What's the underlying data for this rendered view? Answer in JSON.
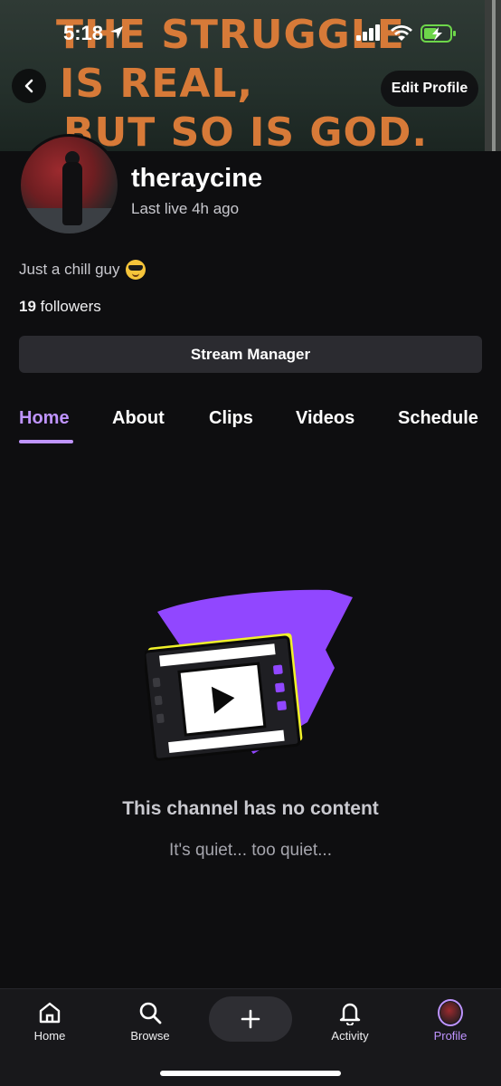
{
  "status_bar": {
    "time": "5:18"
  },
  "banner": {
    "lines": [
      "THE STRUGGLE",
      "IS REAL,",
      "BUT SO IS GOD."
    ]
  },
  "header": {
    "edit_profile_label": "Edit Profile"
  },
  "profile": {
    "username": "theraycine",
    "last_live": "Last live 4h ago",
    "bio": "Just a chill guy",
    "bio_emoji": "sunglasses-emoji",
    "followers_count": "19",
    "followers_label": "followers",
    "stream_manager_label": "Stream Manager"
  },
  "tabs": [
    {
      "label": "Home",
      "active": true
    },
    {
      "label": "About",
      "active": false
    },
    {
      "label": "Clips",
      "active": false
    },
    {
      "label": "Videos",
      "active": false
    },
    {
      "label": "Schedule",
      "active": false
    }
  ],
  "empty_state": {
    "title": "This channel has no content",
    "subtitle": "It's quiet... too quiet..."
  },
  "bottom_nav": {
    "items": [
      {
        "label": "Home",
        "icon": "home-icon"
      },
      {
        "label": "Browse",
        "icon": "search-icon"
      },
      {
        "label": "",
        "icon": "plus-icon"
      },
      {
        "label": "Activity",
        "icon": "bell-icon"
      },
      {
        "label": "Profile",
        "icon": "avatar-icon",
        "active": true
      }
    ]
  },
  "colors": {
    "accent": "#bf94ff",
    "background": "#0e0e10",
    "banner_text": "#d77a38",
    "illustration_purple": "#9147ff",
    "illustration_yellow": "#f1f22a"
  }
}
